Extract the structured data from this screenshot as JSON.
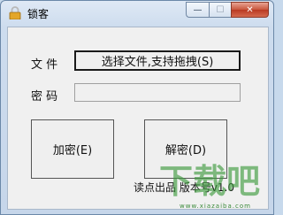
{
  "window": {
    "title": "锁客",
    "min_label": "—",
    "max_label": "☐",
    "close_label": "✕"
  },
  "form": {
    "file_label": "文 件",
    "file_button": "选择文件,支持拖拽(S)",
    "password_label": "密 码",
    "password_value": ""
  },
  "actions": {
    "encrypt": "加密(E)",
    "decrypt": "解密(D)"
  },
  "footer": {
    "text": "读点出品 版本号v1.0"
  },
  "watermark": {
    "logo_text": "下载吧",
    "url": "www.xiazaiba.com"
  },
  "colors": {
    "title_bg": "#dfe9f5",
    "client_bg": "#f0f0f0",
    "close_button": "#c8553c",
    "watermark_green": "#3b8a3b"
  }
}
